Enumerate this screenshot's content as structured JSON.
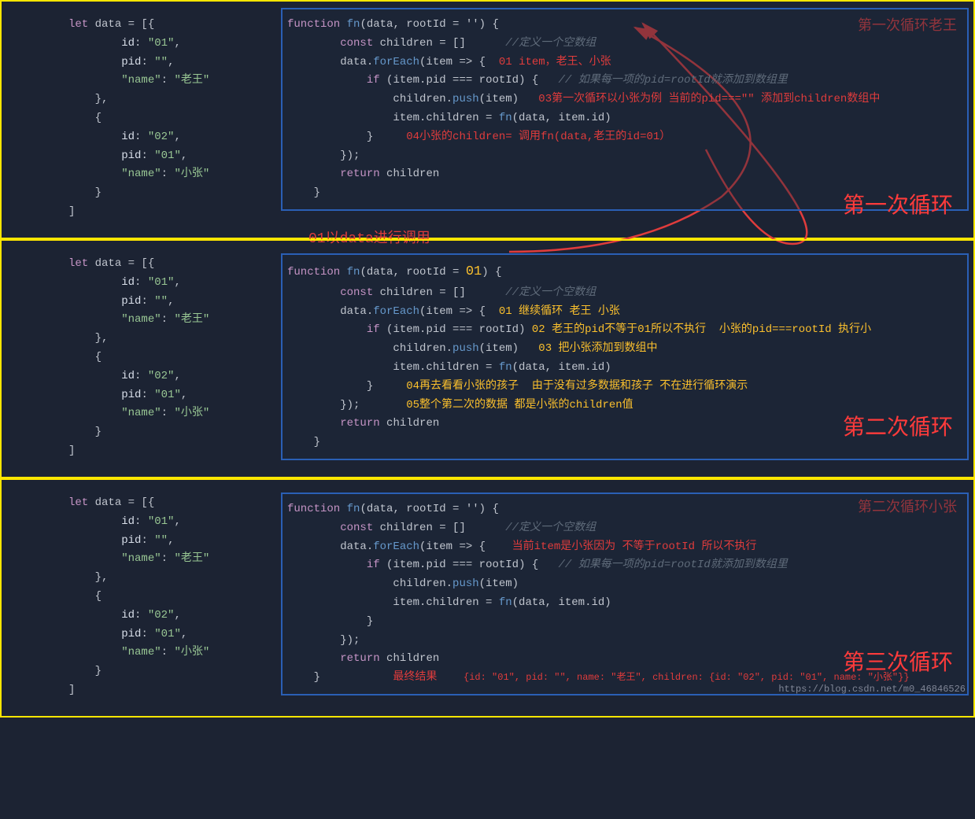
{
  "common": {
    "let": "let",
    "data_decl": "data = [{",
    "id": "id",
    "pid": "pid",
    "name_key": "\"name\"",
    "v01": "\"01\"",
    "v02": "\"02\"",
    "vEmpty": "\"\"",
    "laowang": "\"老王\"",
    "xiaozhang": "\"小张\"",
    "function": "function",
    "fn": "fn",
    "fn_params1": "(data, rootId = '') {",
    "fn_params2_a": "(data, rootId = ",
    "fn_params2_b": "01",
    "fn_params2_c": ") {",
    "const": "const",
    "children_decl": "children = []",
    "forEach": "forEach",
    "forEach_tail": "(item => {",
    "if": "if",
    "if_cond": "(item.pid === rootId) {",
    "push": "push",
    "push_tail": "(item)",
    "assign_children": "item.children = ",
    "fn_call": "(data, item.id)",
    "return": "return",
    "children_word": "children",
    "cmt_empty_arr": "//定义一个空数组",
    "cmt_pid_root": "// 如果每一项的pid=rootId就添加到数组里"
  },
  "p1": {
    "label_top": "第一次循环老王",
    "c1": "01 item，老王、小张",
    "c2": "03第一次循环以小张为例 当前的pid===\"\" 添加到children数组中",
    "c3": "04小张的children= 调用fn(data,老王的id=01）",
    "big": "第一次循环",
    "under": "01以data进行调用"
  },
  "p2": {
    "c1": "01 继续循环 老王 小张",
    "c2": "02 老王的pid不等于01所以不执行  小张的pid===rootId 执行小",
    "c3": "03 把小张添加到数组中",
    "c4": "04再去看看小张的孩子  由于没有过多数据和孩子 不在进行循环演示",
    "c5": "05整个第二次的数据 都是小张的children值",
    "big": "第二次循环"
  },
  "p3": {
    "label_top": "第二次循环小张",
    "c1": "当前item是小张因为 不等于rootId 所以不执行",
    "big": "第三次循环",
    "result_lbl": "最终结果",
    "result_val": "{id: \"01\", pid: \"\", name: \"老王\", children: {id: \"02\", pid: \"01\", name: \"小张\"}}",
    "watermark": "https://blog.csdn.net/m0_46846526"
  }
}
